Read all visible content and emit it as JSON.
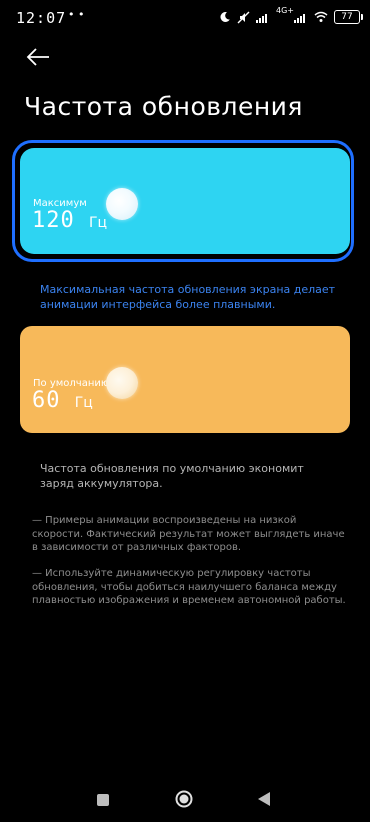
{
  "status_bar": {
    "time": "12:07",
    "extra": "• •",
    "network": "4G+",
    "battery": "77"
  },
  "header": {
    "title": "Частота обновления"
  },
  "options": [
    {
      "label": "Максимум",
      "value": "120",
      "unit": "Гц",
      "selected": true,
      "color": "#2ed4f2"
    },
    {
      "label": "По умолчанию",
      "value": "60",
      "unit": "Гц",
      "selected": false,
      "color": "#f7b95a"
    }
  ],
  "descriptions": {
    "max": "Максимальная частота обновления экрана делает анимации интерфейса более плавными.",
    "default": "Частота обновления по умолчанию экономит заряд аккумулятора."
  },
  "notes": [
    "— Примеры анимации воспроизведены на низкой скорости. Фактический результат может выглядеть иначе в зависимости от различных факторов.",
    "— Используйте динамическую регулировку частоты обновления, чтобы добиться наилучшего баланса между плавностью изображения и временем автономной работы."
  ],
  "colors": {
    "accent": "#1f6fff",
    "link_text": "#3b83f0",
    "background": "#000000"
  },
  "icons": {
    "back": "arrow-left-icon",
    "nav_recent": "square-icon",
    "nav_home": "circle-icon",
    "nav_back": "triangle-icon"
  }
}
